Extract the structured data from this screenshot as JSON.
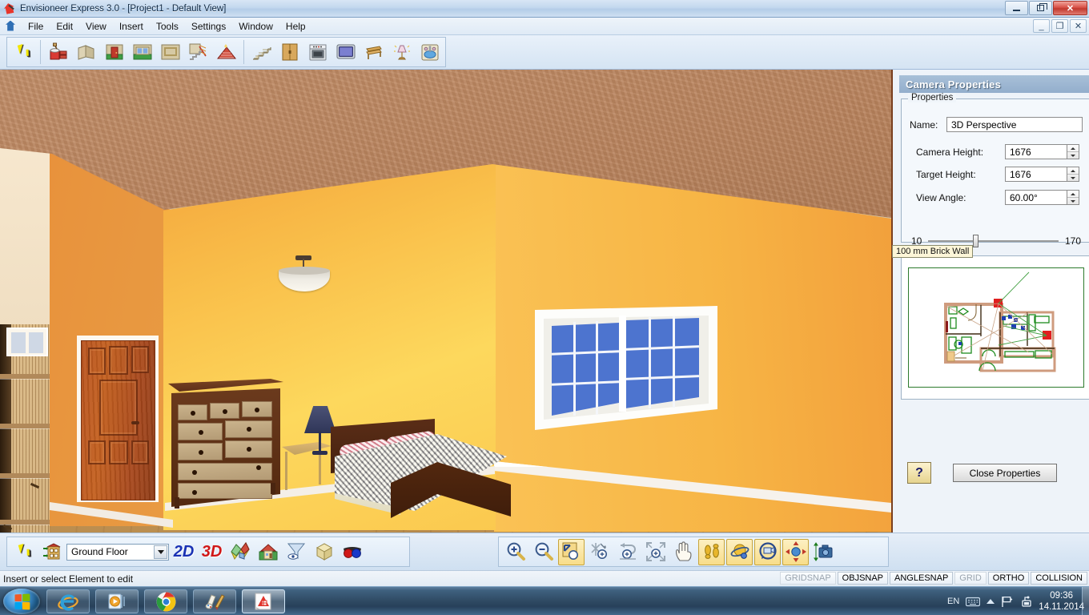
{
  "window": {
    "title": "Envisioneer Express 3.0 - [Project1 - Default View]",
    "app_icon": "house-pencil-icon",
    "controls": {
      "minimize": "minimize-icon",
      "maximize": "maximize-icon",
      "close": "close-icon"
    },
    "mdi_controls": {
      "minimize": "mdi-minimize-icon",
      "restore": "mdi-restore-icon",
      "close": "mdi-close-icon"
    }
  },
  "menu": {
    "icon": "mdi-document-icon",
    "items": [
      "File",
      "Edit",
      "View",
      "Insert",
      "Tools",
      "Settings",
      "Window",
      "Help"
    ]
  },
  "toolbar": {
    "items": [
      {
        "name": "select-pointer-tool",
        "icon": "arrow-cursor-icon",
        "label": "Select"
      },
      {
        "name": "material-paint-tool",
        "icon": "paint-bucket-brick-icon",
        "label": "Materials"
      },
      {
        "name": "wall-tool",
        "icon": "wall-icon",
        "label": "Wall"
      },
      {
        "name": "door-tool",
        "icon": "door-icon",
        "label": "Door"
      },
      {
        "name": "window-tool",
        "icon": "window-icon",
        "label": "Window"
      },
      {
        "name": "opening-tool",
        "icon": "opening-icon",
        "label": "Opening"
      },
      {
        "name": "stair-rail-tool",
        "icon": "stair-railing-icon",
        "label": "Stairs and Railings"
      },
      {
        "name": "roof-tool",
        "icon": "roof-icon",
        "label": "Roof"
      },
      {
        "name": "deck-stairs-tool",
        "icon": "deck-stairs-icon",
        "label": "Deck Stairs"
      },
      {
        "name": "cabinet-tool",
        "icon": "cabinet-icon",
        "label": "Cabinets"
      },
      {
        "name": "appliance-tool",
        "icon": "stove-appliance-icon",
        "label": "Appliances"
      },
      {
        "name": "electronics-tool",
        "icon": "television-icon",
        "label": "Electronics"
      },
      {
        "name": "furniture-tool",
        "icon": "bench-furniture-icon",
        "label": "Furniture"
      },
      {
        "name": "lighting-tool",
        "icon": "table-lamp-icon",
        "label": "Lighting"
      },
      {
        "name": "plumbing-tool",
        "icon": "sink-faucet-icon",
        "label": "Plumbing"
      }
    ]
  },
  "properties_panel": {
    "title": "Camera Properties",
    "group_legend": "Properties",
    "fields": [
      {
        "label": "Name:",
        "value": "3D Perspective",
        "name": "camera-name-field"
      },
      {
        "label": "Camera Height:",
        "value": "1676",
        "name": "camera-height-field"
      },
      {
        "label": "Target Height:",
        "value": "1676",
        "name": "target-height-field"
      },
      {
        "label": "View Angle:",
        "value": "60.00°",
        "name": "view-angle-field"
      }
    ],
    "slider": {
      "min": "10",
      "max": "170",
      "name": "view-angle-slider"
    },
    "map_tooltip": "100 mm Brick Wall",
    "map_tools": [
      {
        "name": "map-zoom-in-button",
        "icon": "zoom-in-icon"
      },
      {
        "name": "map-zoom-out-button",
        "icon": "zoom-out-icon"
      },
      {
        "name": "map-zoom-window-button",
        "icon": "zoom-window-icon"
      },
      {
        "name": "map-zoom-extents-button",
        "icon": "zoom-extents-icon"
      },
      {
        "name": "map-zoom-previous-button",
        "icon": "zoom-previous-icon"
      },
      {
        "name": "map-zoom-selected-button",
        "icon": "zoom-selected-icon"
      },
      {
        "name": "map-pan-button",
        "icon": "pan-hand-icon"
      }
    ],
    "help_label": "?",
    "close_label": "Close Properties"
  },
  "bottom_toolbar_left": {
    "items": [
      {
        "name": "select-tool-button",
        "icon": "arrow-cursor-icon"
      },
      {
        "name": "floor-manager-button",
        "icon": "building-floors-icon"
      }
    ],
    "floor_selector": {
      "value": "Ground Floor",
      "name": "floor-selector",
      "icon": "chevron-down-icon"
    },
    "view_buttons": [
      {
        "name": "view-2d-button",
        "label": "2D"
      },
      {
        "name": "view-3d-button",
        "label": "3D"
      },
      {
        "name": "split-view-button",
        "icon": "split-view-icon"
      },
      {
        "name": "render-view-button",
        "icon": "rendered-house-icon"
      },
      {
        "name": "display-filter-button",
        "icon": "funnel-eye-icon"
      },
      {
        "name": "bounding-box-button",
        "icon": "cube-box-icon"
      },
      {
        "name": "stereo-view-button",
        "icon": "3d-glasses-icon"
      }
    ]
  },
  "bottom_toolbar_right": {
    "items": [
      {
        "name": "zoom-in-button",
        "icon": "zoom-in-icon",
        "active": false
      },
      {
        "name": "zoom-out-button",
        "icon": "zoom-out-icon",
        "active": false
      },
      {
        "name": "zoom-window-button",
        "icon": "zoom-window-icon",
        "active": true
      },
      {
        "name": "zoom-point-button",
        "icon": "zoom-point-icon",
        "active": false
      },
      {
        "name": "zoom-previous-button",
        "icon": "zoom-previous-icon",
        "active": false
      },
      {
        "name": "zoom-extents-button",
        "icon": "zoom-extents-icon",
        "active": false
      },
      {
        "name": "pan-button",
        "icon": "pan-hand-icon",
        "active": false
      },
      {
        "name": "walkthrough-button",
        "icon": "walk-feet-icon",
        "active": true
      },
      {
        "name": "orbit-button",
        "icon": "orbit-sphere-icon",
        "active": true
      },
      {
        "name": "turn-camera-button",
        "icon": "turn-camera-icon",
        "active": true
      },
      {
        "name": "move-camera-button",
        "icon": "move-four-arrows-icon",
        "active": true
      },
      {
        "name": "camera-height-button",
        "icon": "camera-height-icon",
        "active": false
      }
    ]
  },
  "statusbar": {
    "message": "Insert or select Element to edit",
    "snaps": [
      {
        "label": "GRIDSNAP",
        "enabled": false
      },
      {
        "label": "OBJSNAP",
        "enabled": true
      },
      {
        "label": "ANGLESNAP",
        "enabled": true
      },
      {
        "label": "GRID",
        "enabled": false
      },
      {
        "label": "ORTHO",
        "enabled": true
      },
      {
        "label": "COLLISION",
        "enabled": true
      }
    ]
  },
  "taskbar": {
    "start": {
      "name": "start-button",
      "icon": "windows-logo-icon"
    },
    "items": [
      {
        "name": "taskbar-internet-explorer",
        "icon": "internet-explorer-icon"
      },
      {
        "name": "taskbar-media-player",
        "icon": "windows-media-player-icon"
      },
      {
        "name": "taskbar-chrome",
        "icon": "google-chrome-icon"
      },
      {
        "name": "taskbar-paint",
        "icon": "paint-icon"
      },
      {
        "name": "taskbar-envisioneer",
        "icon": "envisioneer-icon"
      }
    ],
    "tray": {
      "language": "EN",
      "icons": [
        "keyboard-icon",
        "show-hidden-icons-icon",
        "action-center-flag-icon",
        "network-icon"
      ],
      "time": "09:36",
      "date": "14.11.2014"
    }
  },
  "viewport": {
    "name": "3d-render-viewport",
    "scene": "bedroom-interior-3d-perspective",
    "colors": {
      "ceiling": "#b9845f",
      "wall_bright": "#fbc94f",
      "wall_orange": "#f2a03c",
      "floor": "#c79c5e",
      "window_glass": "#4d74cf",
      "door": "#b9531f",
      "bed_frame": "#46210f"
    }
  }
}
